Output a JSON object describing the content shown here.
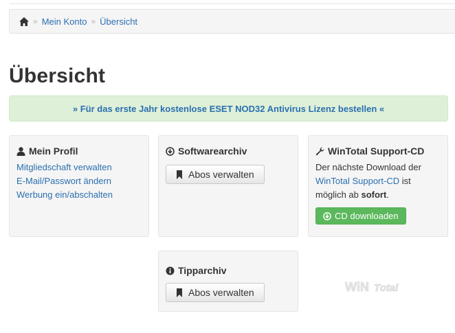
{
  "breadcrumb": {
    "home_icon": "home-icon",
    "sep1": "»",
    "item1": "Mein Konto",
    "sep2": "»",
    "item2": "Übersicht"
  },
  "page_title": "Übersicht",
  "promo": {
    "text": "» Für das erste Jahr kostenlose ESET NOD32 Antivirus Lizenz bestellen «"
  },
  "profile": {
    "title": "Mein Profil",
    "icon": "user-icon",
    "links": [
      "Mitgliedschaft verwalten",
      "E-Mail/Passwort ändern",
      "Werbung ein/abschalten"
    ]
  },
  "software": {
    "title": "Softwarearchiv",
    "icon": "download-circle-icon",
    "button": "Abos verwalten"
  },
  "support": {
    "title": "WinTotal Support-CD",
    "icon": "wrench-icon",
    "line1": "Der nächste Download der",
    "link": "WinTotal Support-CD",
    "after_link": " ist",
    "line3_prefix": "möglich ab ",
    "line3_bold": "sofort",
    "line3_suffix": ".",
    "button": "CD downloaden"
  },
  "tips": {
    "title": "Tipparchiv",
    "icon": "info-circle-icon",
    "button": "Abos verwalten"
  },
  "colors": {
    "link": "#2a6fb0",
    "promo_bg": "#dff0d8",
    "green_button": "#5cb85c",
    "panel_bg": "#f5f5f5"
  }
}
